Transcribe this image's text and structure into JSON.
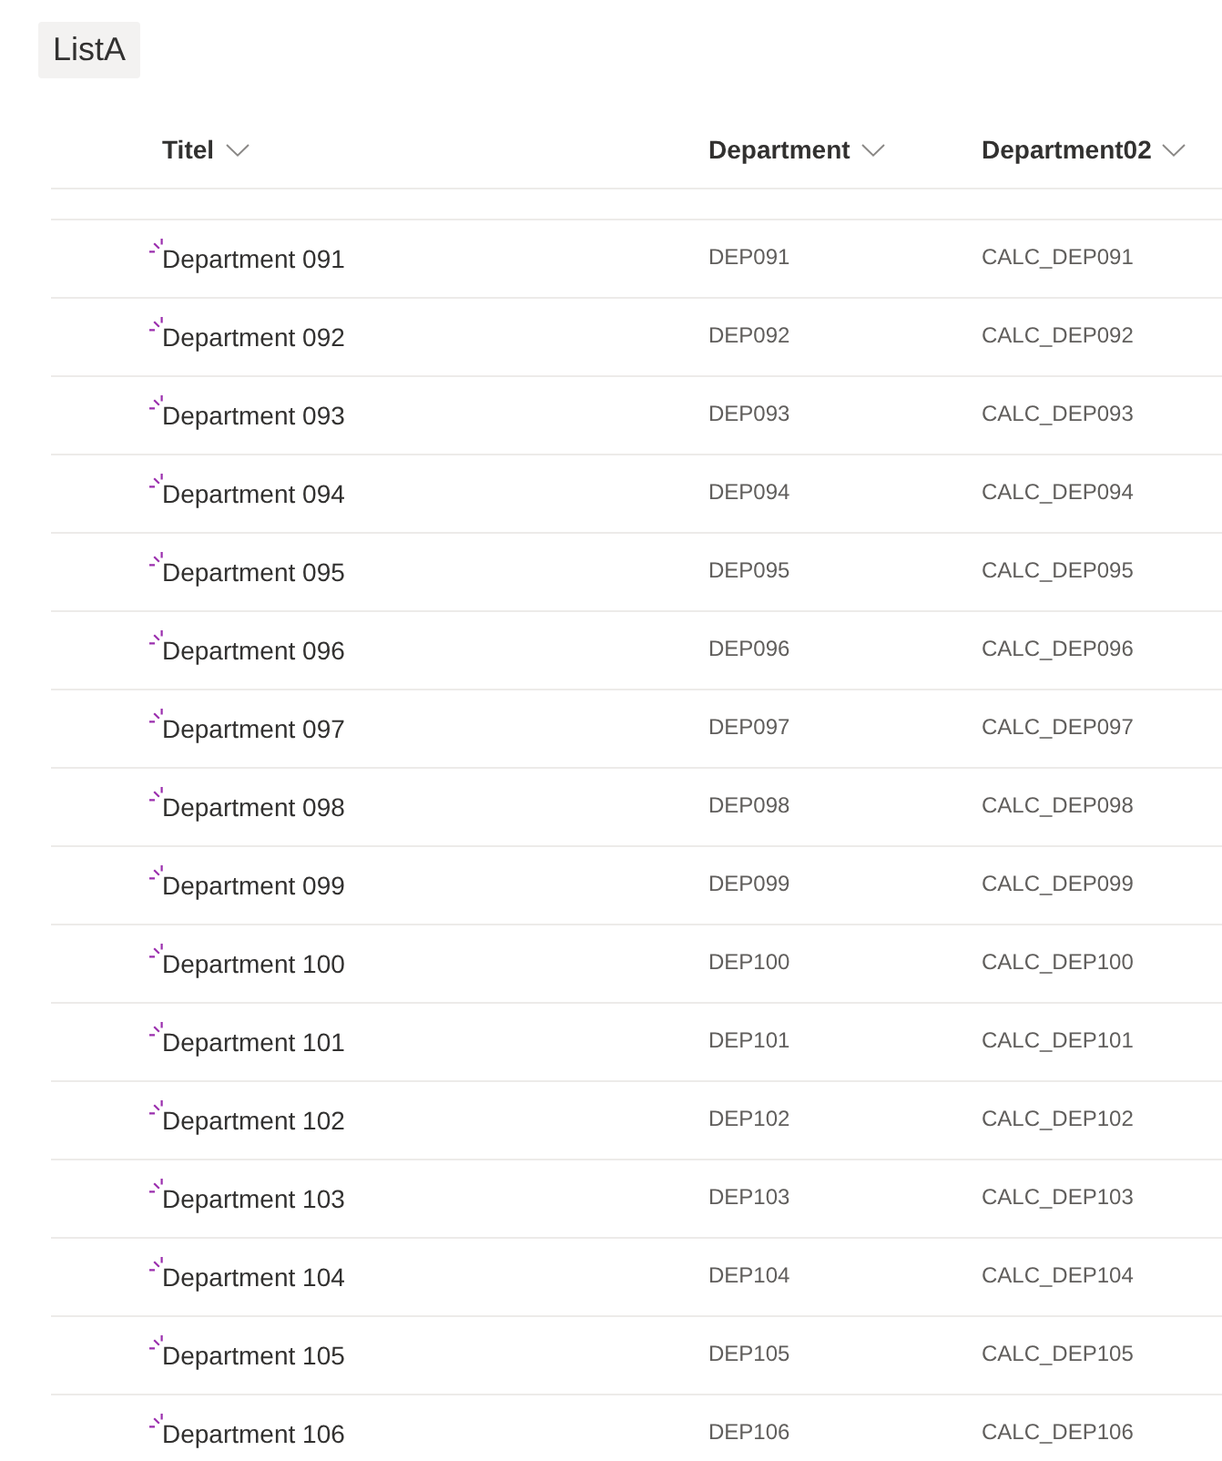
{
  "list_title": "ListA",
  "columns": [
    {
      "label": "Titel"
    },
    {
      "label": "Department"
    },
    {
      "label": "Department02"
    }
  ],
  "rows": [
    {
      "title": "Department 091",
      "department": "DEP091",
      "department02": "CALC_DEP091",
      "new": true
    },
    {
      "title": "Department 092",
      "department": "DEP092",
      "department02": "CALC_DEP092",
      "new": true
    },
    {
      "title": "Department 093",
      "department": "DEP093",
      "department02": "CALC_DEP093",
      "new": true
    },
    {
      "title": "Department 094",
      "department": "DEP094",
      "department02": "CALC_DEP094",
      "new": true
    },
    {
      "title": "Department 095",
      "department": "DEP095",
      "department02": "CALC_DEP095",
      "new": true
    },
    {
      "title": "Department 096",
      "department": "DEP096",
      "department02": "CALC_DEP096",
      "new": true
    },
    {
      "title": "Department 097",
      "department": "DEP097",
      "department02": "CALC_DEP097",
      "new": true
    },
    {
      "title": "Department 098",
      "department": "DEP098",
      "department02": "CALC_DEP098",
      "new": true
    },
    {
      "title": "Department 099",
      "department": "DEP099",
      "department02": "CALC_DEP099",
      "new": true
    },
    {
      "title": "Department 100",
      "department": "DEP100",
      "department02": "CALC_DEP100",
      "new": true
    },
    {
      "title": "Department 101",
      "department": "DEP101",
      "department02": "CALC_DEP101",
      "new": true
    },
    {
      "title": "Department 102",
      "department": "DEP102",
      "department02": "CALC_DEP102",
      "new": true
    },
    {
      "title": "Department 103",
      "department": "DEP103",
      "department02": "CALC_DEP103",
      "new": true
    },
    {
      "title": "Department 104",
      "department": "DEP104",
      "department02": "CALC_DEP104",
      "new": true
    },
    {
      "title": "Department 105",
      "department": "DEP105",
      "department02": "CALC_DEP105",
      "new": true
    },
    {
      "title": "Department 106",
      "department": "DEP106",
      "department02": "CALC_DEP106",
      "new": true
    }
  ]
}
